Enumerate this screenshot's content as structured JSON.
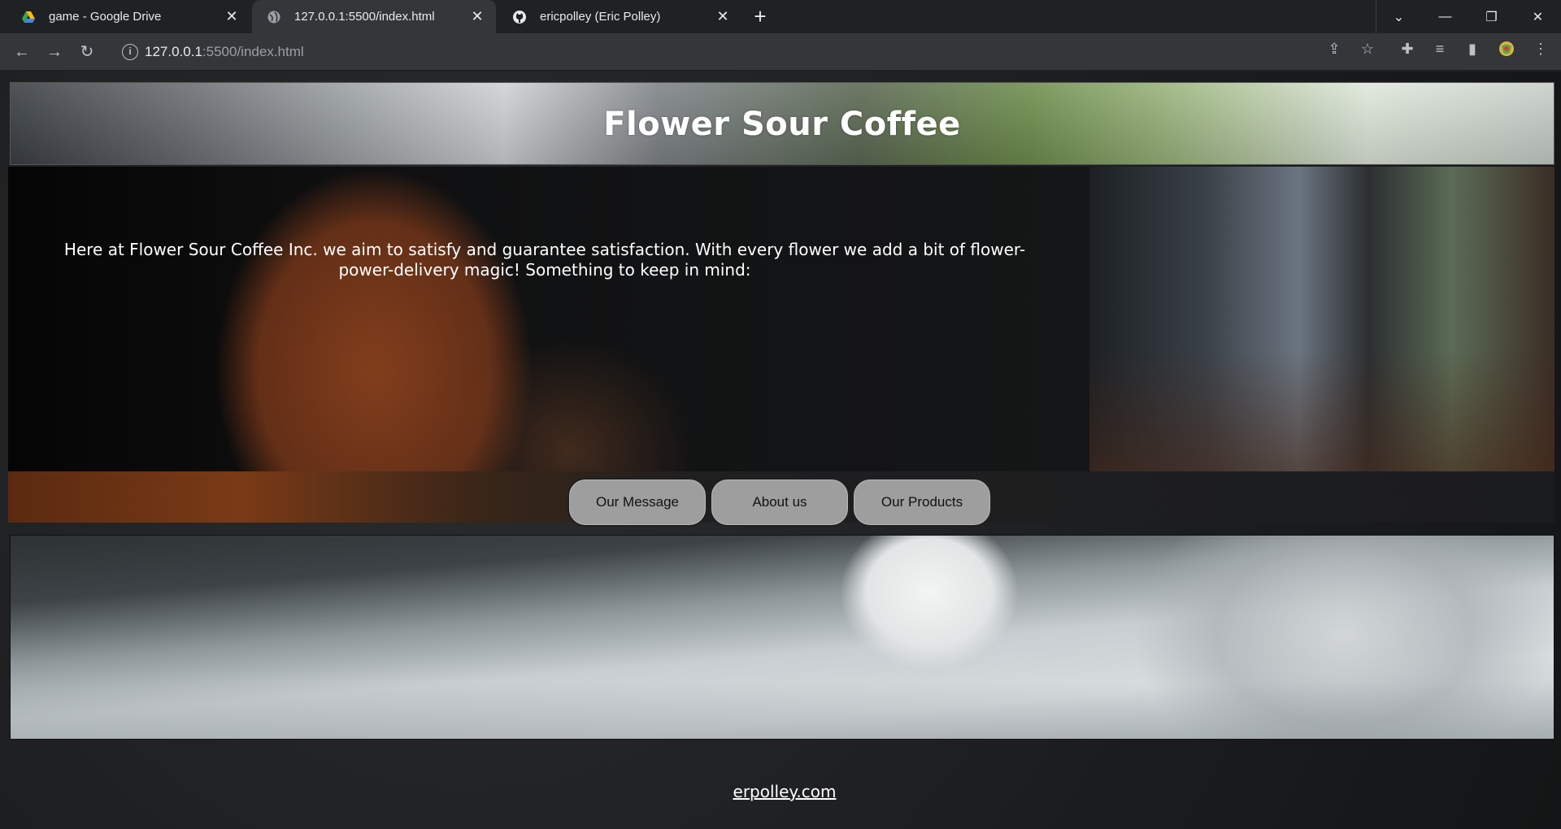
{
  "browser": {
    "tabs": [
      {
        "title": "game - Google Drive",
        "icon": "google-drive-icon",
        "active": false
      },
      {
        "title": "127.0.0.1:5500/index.html",
        "icon": "globe-icon",
        "active": true
      },
      {
        "title": "ericpolley (Eric Polley)",
        "icon": "github-icon",
        "active": false
      }
    ],
    "new_tab_symbol": "+",
    "address": {
      "host": "127.0.0.1",
      "path": ":5500/index.html"
    }
  },
  "page": {
    "title": "Flower Sour Coffee",
    "intro": "Here at Flower Sour Coffee Inc. we aim to satisfy and guarantee satisfaction. With every flower we add a bit of flower-power-delivery magic! Something to keep in mind:",
    "nav": [
      "Our Message",
      "About us",
      "Our Products"
    ],
    "footer_link": "erpolley.com"
  },
  "colors": {
    "chrome_bg": "#202124",
    "toolbar_bg": "#35363a",
    "nav_button_bg": "#9e9e9e",
    "text_light": "#ffffff"
  }
}
